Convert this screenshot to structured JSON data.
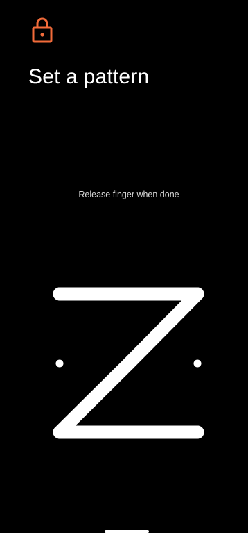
{
  "header": {
    "icon": "lock-icon",
    "title": "Set a pattern"
  },
  "pattern": {
    "hint": "Release finger when done",
    "grid_size": 3,
    "dots": [
      {
        "row": 0,
        "col": 0,
        "selected": true
      },
      {
        "row": 0,
        "col": 1,
        "selected": true
      },
      {
        "row": 0,
        "col": 2,
        "selected": true
      },
      {
        "row": 1,
        "col": 0,
        "selected": false
      },
      {
        "row": 1,
        "col": 1,
        "selected": true
      },
      {
        "row": 1,
        "col": 2,
        "selected": false
      },
      {
        "row": 2,
        "col": 0,
        "selected": true
      },
      {
        "row": 2,
        "col": 1,
        "selected": true
      },
      {
        "row": 2,
        "col": 2,
        "selected": true
      }
    ],
    "sequence": [
      [
        0,
        0
      ],
      [
        0,
        1
      ],
      [
        0,
        2
      ],
      [
        1,
        1
      ],
      [
        2,
        0
      ],
      [
        2,
        1
      ],
      [
        2,
        2
      ]
    ]
  },
  "colors": {
    "background": "#000000",
    "accent": "#f26b3a",
    "pattern_line": "#ffffff",
    "hint_text": "#d8d8d8"
  }
}
